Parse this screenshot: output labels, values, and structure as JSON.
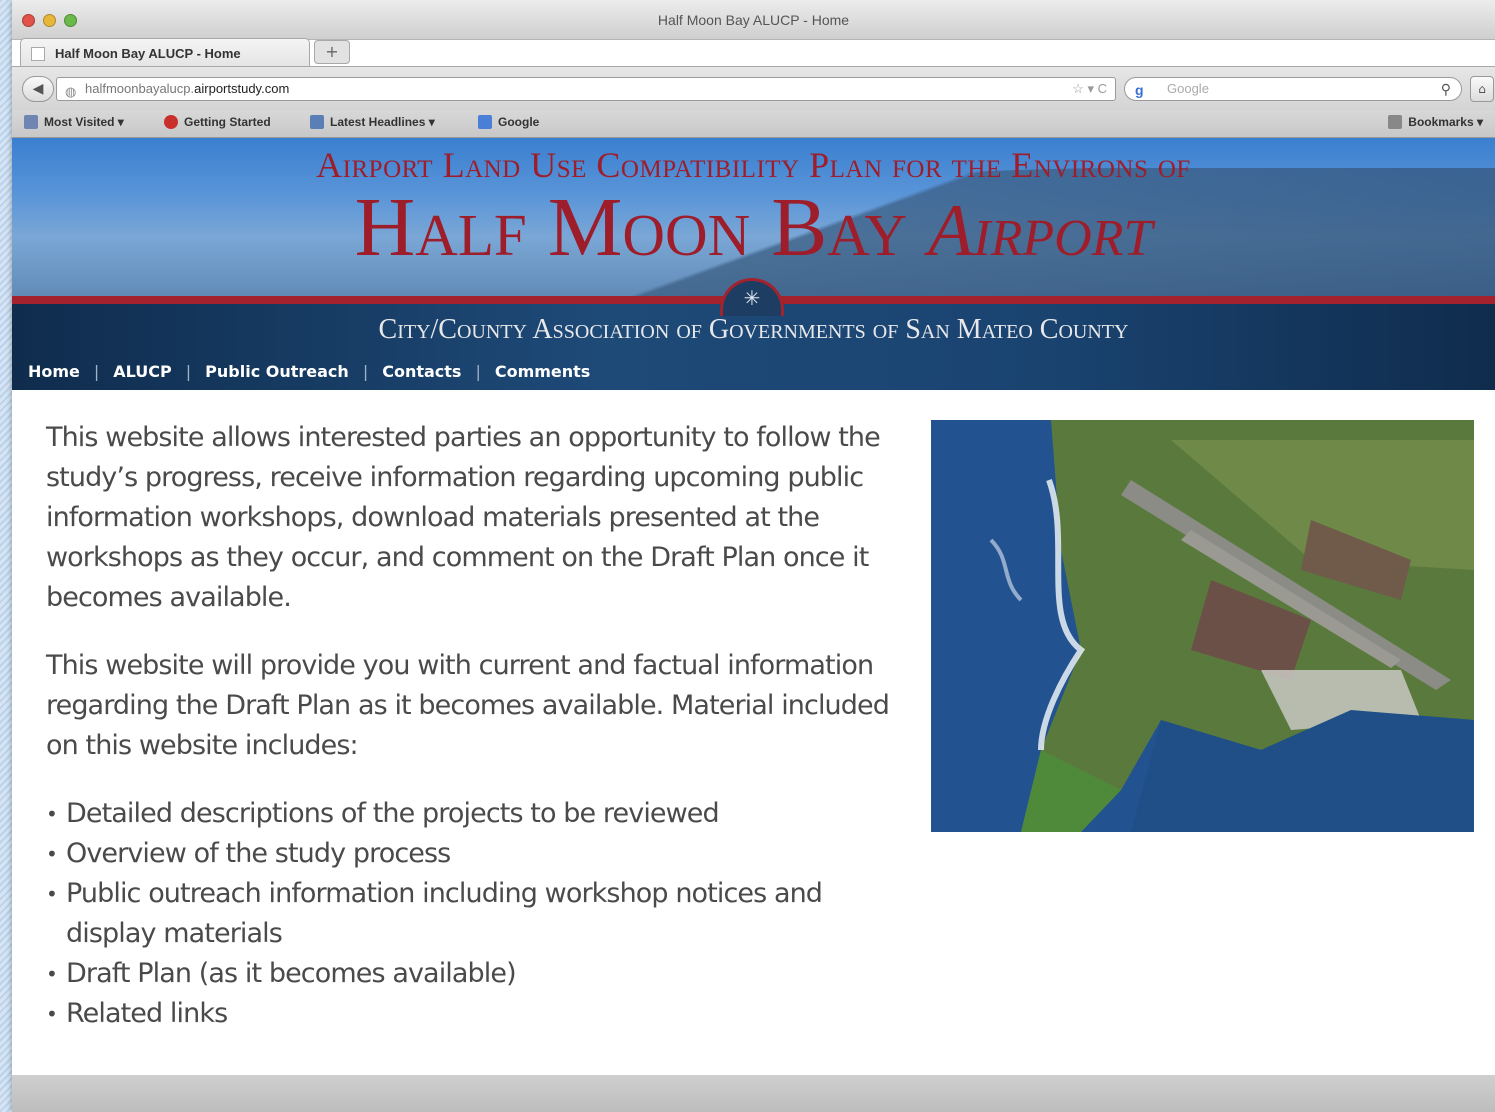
{
  "window": {
    "title": "Half Moon Bay ALUCP - Home"
  },
  "tab": {
    "label": "Half Moon Bay ALUCP - Home",
    "new_tab_label": "+"
  },
  "toolbar": {
    "back_glyph": "◀",
    "url_prefix": "halfmoonbayalucp.",
    "url_domain": "airportstudy.com",
    "url_tools": "☆ ▾ C",
    "search_engine_glyph": "g",
    "search_placeholder": "Google",
    "search_glyph": "⚲",
    "home_glyph": "⌂"
  },
  "bookmarks": [
    {
      "label": "Most Visited ▾",
      "icon": "most-visited-icon",
      "color": "#6f86b3"
    },
    {
      "label": "Getting Started",
      "icon": "getting-started-icon",
      "color": "#c9302c"
    },
    {
      "label": "Latest Headlines ▾",
      "icon": "rss-icon",
      "color": "#5a7fb5"
    },
    {
      "label": "Google",
      "icon": "google-icon",
      "color": "#4a7fd8"
    }
  ],
  "bookmarks_menu": "Bookmarks ▾",
  "header": {
    "line1": "Airport Land Use Compatibility Plan for the Environs of",
    "line2_main": "Half Moon Bay",
    "line2_script": "Airport",
    "emblem": "✳",
    "subtitle": "City/County Association of Governments of San Mateo County"
  },
  "nav": {
    "items": [
      "Home",
      "ALUCP",
      "Public Outreach",
      "Contacts",
      "Comments"
    ],
    "separator": "|"
  },
  "content": {
    "paragraph1": "This website allows interested parties an opportunity to follow the study’s progress, receive information regarding upcoming public information workshops, download materials presented at the workshops as they occur, and comment on the Draft Plan once it becomes available.",
    "paragraph2": "This website will provide you with current and factual information regarding the Draft Plan as it becomes available. Material included on this website includes:",
    "bullets": [
      "Detailed descriptions of the projects to be reviewed",
      "Overview of the study process",
      "Public outreach information including workshop notices and display materials",
      "Draft Plan (as it becomes available)",
      "Related links"
    ]
  },
  "colors": {
    "brand_red": "#9e1d2a",
    "header_blue": "#3a7fd0",
    "nav_navy": "#0f2c4d"
  }
}
